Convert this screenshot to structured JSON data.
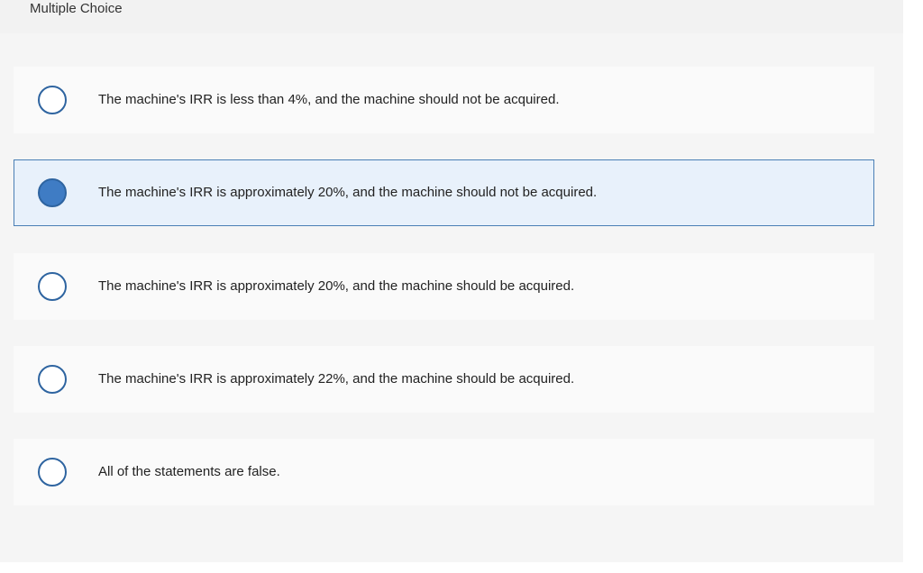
{
  "header": {
    "title": "Multiple Choice"
  },
  "choices": [
    {
      "text": "The machine's IRR is less than 4%, and the machine should not be acquired.",
      "selected": false
    },
    {
      "text": "The machine's IRR is approximately 20%, and the machine should not be acquired.",
      "selected": true
    },
    {
      "text": "The machine's IRR is approximately 20%, and the machine should be acquired.",
      "selected": false
    },
    {
      "text": "The machine's IRR is approximately 22%, and the machine should be acquired.",
      "selected": false
    },
    {
      "text": "All of the statements are false.",
      "selected": false
    }
  ],
  "colors": {
    "radio_border": "#2e64a0",
    "radio_selected_fill": "#3f7cc4",
    "selected_background": "#e8f1fb",
    "selected_border": "#4a7fb5"
  }
}
